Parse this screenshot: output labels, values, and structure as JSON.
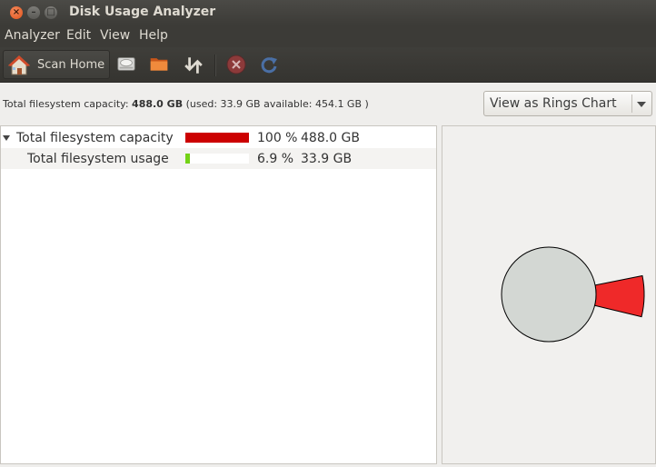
{
  "window": {
    "title": "Disk Usage Analyzer",
    "controls": {
      "close": "×",
      "minimize": "–",
      "maximize": "□"
    }
  },
  "menubar": [
    "Analyzer",
    "Edit",
    "View",
    "Help"
  ],
  "toolbar": {
    "scan_home_label": "Scan Home",
    "icons": [
      "home-icon",
      "scan-filesystem-icon",
      "scan-folder-icon",
      "scan-remote-icon",
      "stop-icon",
      "refresh-icon"
    ]
  },
  "info": {
    "prefix": "Total filesystem capacity: ",
    "capacity": "488.0 GB",
    "details": " (used: 33.9 GB available: 454.1 GB )"
  },
  "view_select": {
    "value": "View as Rings Chart"
  },
  "tree": {
    "rows": [
      {
        "name": "Total filesystem capacity",
        "percent": "100 %",
        "size": "488.0 GB",
        "usage_fraction": 1.0,
        "bar_color": "#cc0000"
      },
      {
        "name": "Total filesystem usage",
        "percent": "6.9 %",
        "size": "33.9 GB",
        "usage_fraction": 0.069,
        "bar_color": "#73d216"
      }
    ]
  },
  "rings_chart": {
    "center_color": "#d3d7d3",
    "segment_color": "#ef2929",
    "segment_fraction": 0.069
  },
  "colors": {
    "titlebar": "#3c3b37",
    "accent_close": "#e0531b",
    "background": "#efeeec"
  }
}
